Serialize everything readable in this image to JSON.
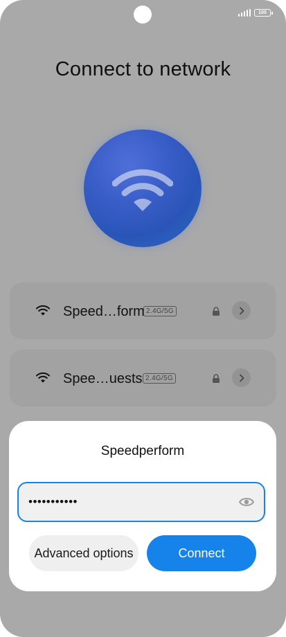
{
  "page": {
    "title": "Connect to network"
  },
  "status_bar": {
    "battery": "100",
    "signal_icon": "signal-icon",
    "battery_icon": "battery-icon"
  },
  "hero": {
    "icon": "wifi-icon",
    "color": "#3a5ec8"
  },
  "networks": [
    {
      "name": "Speed…form",
      "band": "2.4G/5G",
      "secured": true
    },
    {
      "name": "Spee…uests",
      "band": "2.4G/5G",
      "secured": true
    }
  ],
  "dialog": {
    "title": "Speedperform",
    "password_value": "•••••••••••",
    "advanced_label": "Advanced options",
    "connect_label": "Connect",
    "accent_color": "#1583ea"
  }
}
